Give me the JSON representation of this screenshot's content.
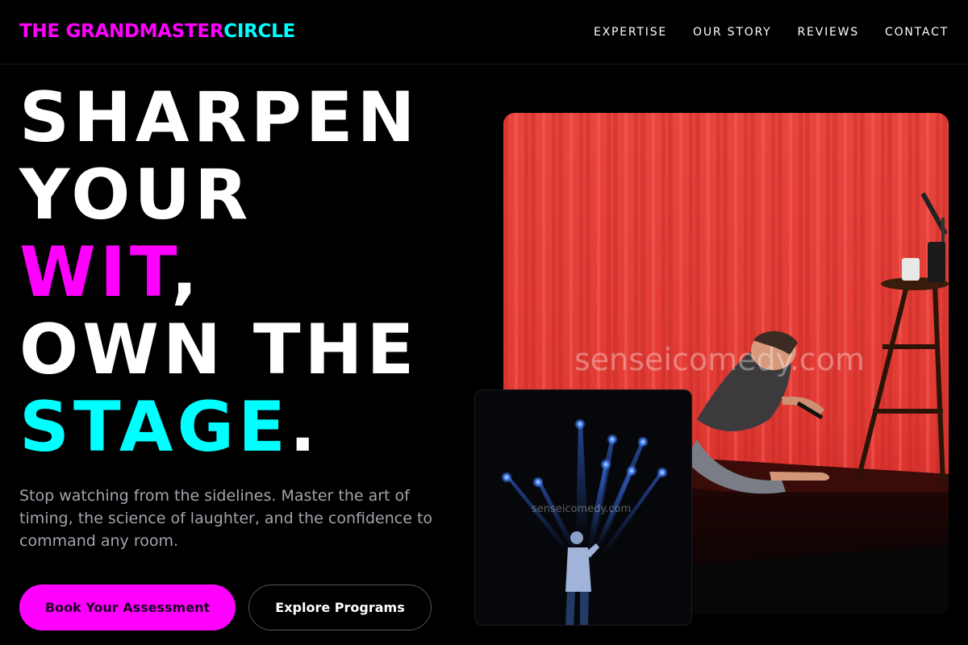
{
  "brand": {
    "part1": "THE GRANDMASTER",
    "part2": "CIRCLE"
  },
  "nav": {
    "items": [
      {
        "label": "EXPERTISE"
      },
      {
        "label": "OUR STORY"
      },
      {
        "label": "REVIEWS"
      },
      {
        "label": "CONTACT"
      }
    ]
  },
  "hero": {
    "line1": "SHARPEN",
    "line2": "YOUR",
    "line3_highlight": "WIT",
    "line3_punct": ",",
    "line4": "OWN THE",
    "line5_highlight": "STAGE",
    "line5_punct": ".",
    "subtext": "Stop watching from the sidelines. Master the art of timing, the science of laughter, and the confidence to command any room.",
    "primary_cta": "Book Your Assessment",
    "secondary_cta": "Explore Programs"
  },
  "images": {
    "main_watermark": "senseicomedy.com",
    "small_watermark": "senseicomedy.com"
  },
  "colors": {
    "magenta": "#ff00ff",
    "cyan": "#00ffff",
    "background": "#000000",
    "curtain": "#e23b35"
  }
}
